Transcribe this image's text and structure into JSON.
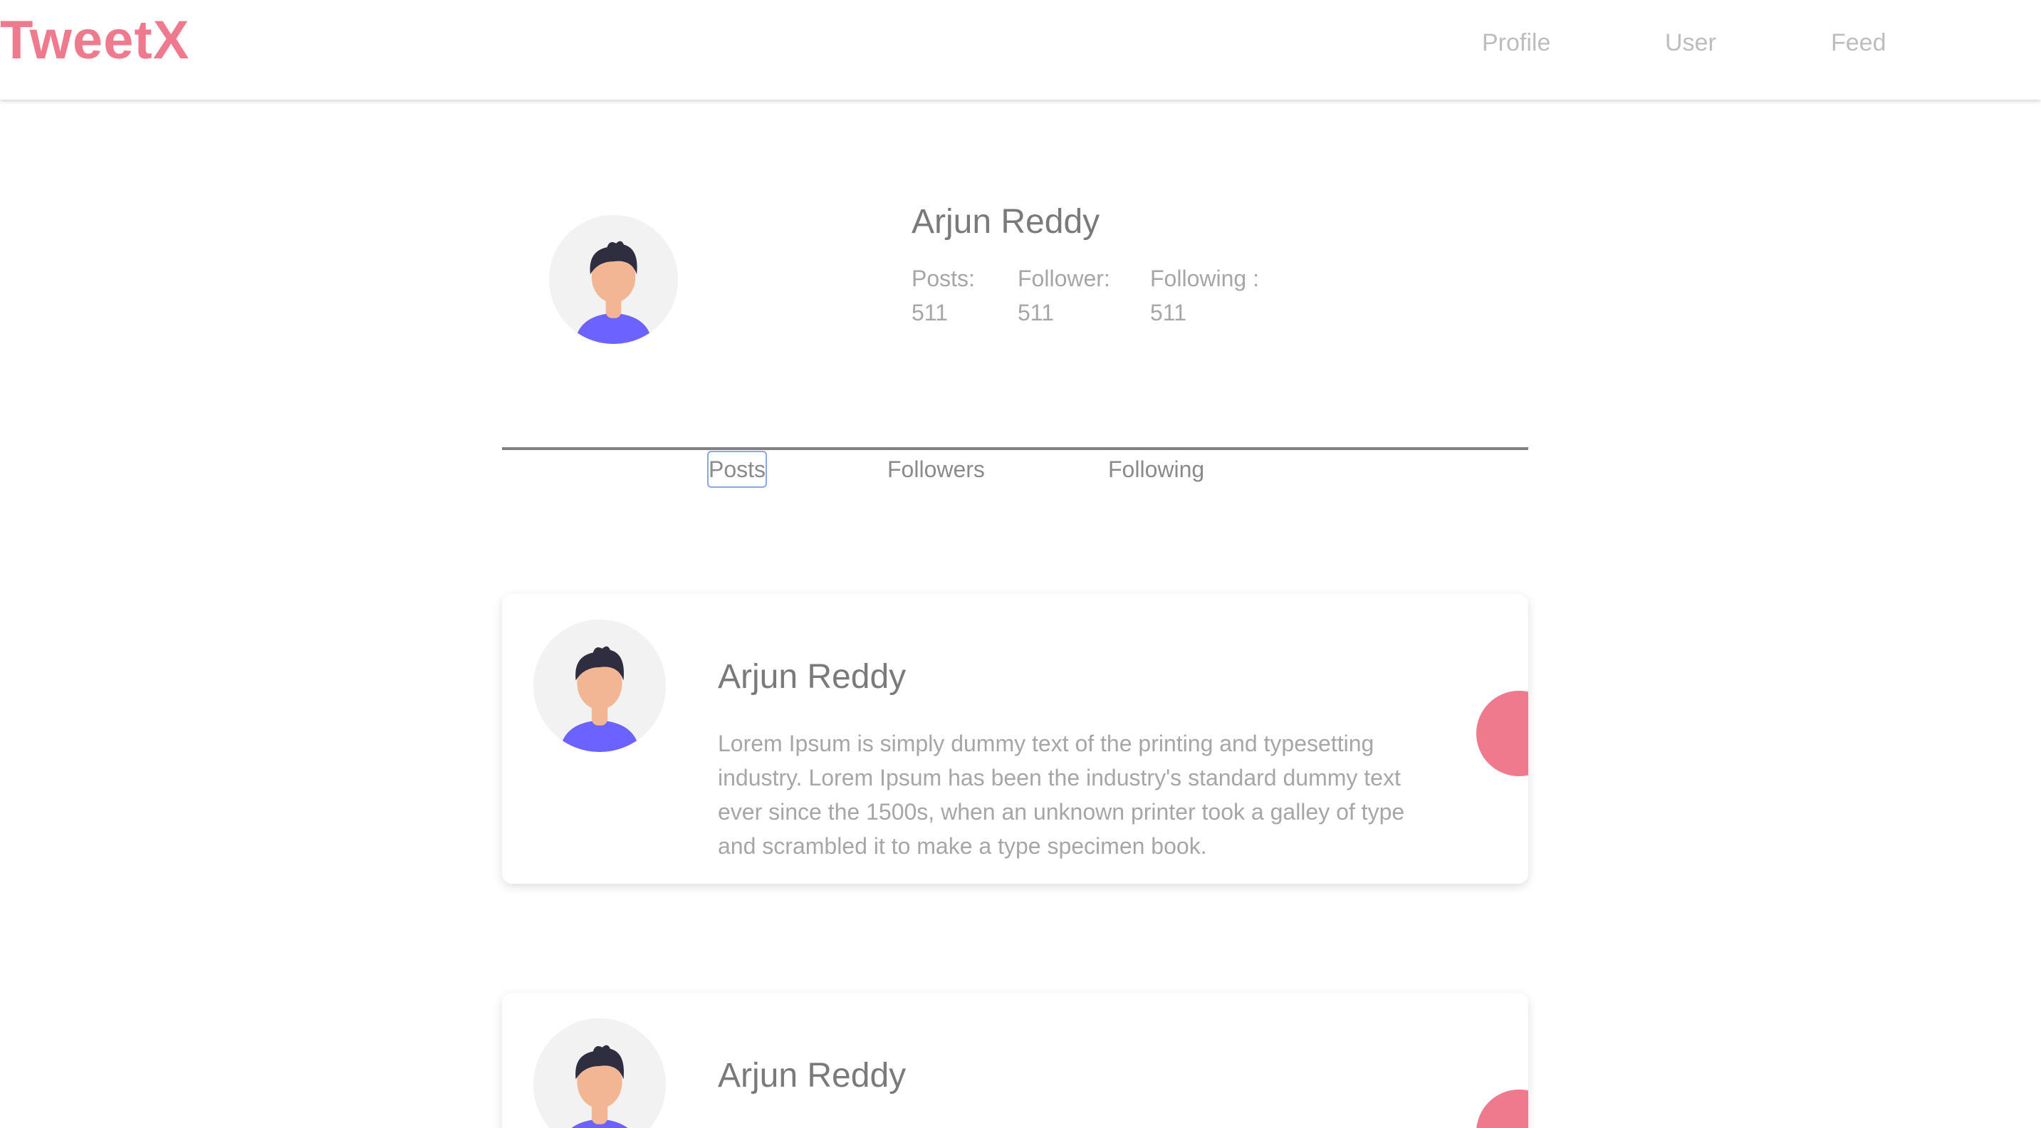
{
  "app": {
    "logo": "TweetX",
    "brand_color": "#ef7a8e"
  },
  "nav": {
    "profile": "Profile",
    "user": "User",
    "feed": "Feed"
  },
  "profile": {
    "name": "Arjun Reddy",
    "avatar_icon": "user-avatar-icon",
    "stats": {
      "posts_label": "Posts:",
      "posts_value": "511",
      "follower_label": "Follower:",
      "follower_value": "511",
      "following_label": "Following :",
      "following_value": "511"
    }
  },
  "tabs": {
    "posts": "Posts",
    "followers": "Followers",
    "following": "Following",
    "active": "posts"
  },
  "posts": [
    {
      "author": "Arjun Reddy",
      "text": "Lorem Ipsum is simply dummy text of the printing and typesetting industry. Lorem Ipsum has been the industry's standard dummy text ever since the 1500s, when an unknown printer took a galley of type and scrambled it to make a type specimen book."
    },
    {
      "author": "Arjun Reddy",
      "text": ""
    }
  ]
}
